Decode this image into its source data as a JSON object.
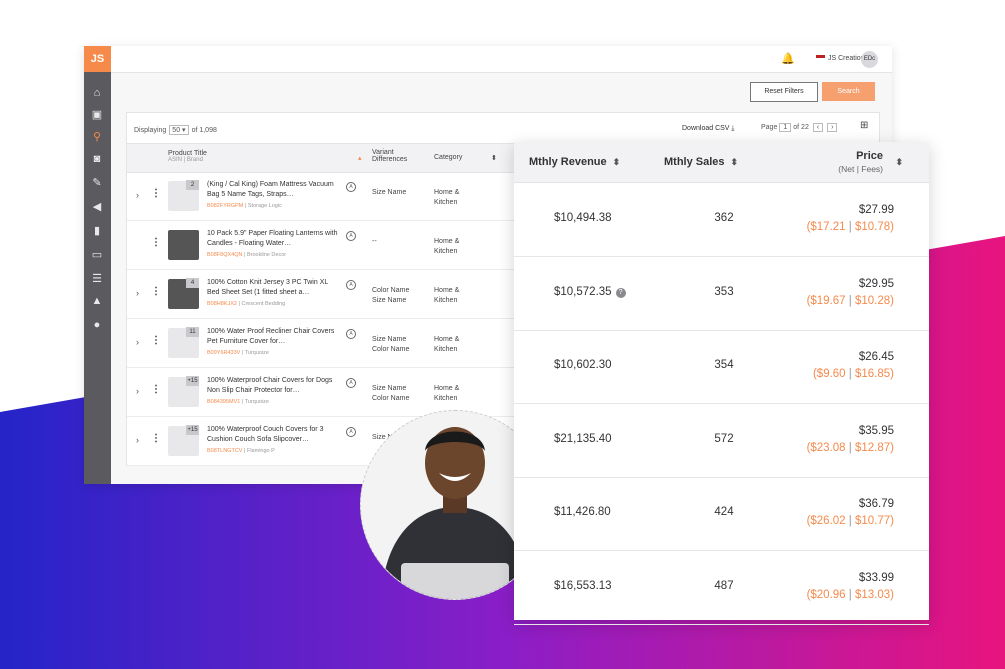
{
  "colors": {
    "accent": "#f58a4b",
    "sidebar": "#5b5b5f",
    "gradient_start": "#2424c8",
    "gradient_mid": "#8a1ec8",
    "gradient_end": "#e8147e"
  },
  "app": {
    "logo": "JS",
    "sidebar_icons": [
      "home-icon",
      "bag-icon",
      "search-icon",
      "binoculars-icon",
      "wrench-icon",
      "megaphone-icon",
      "chart-icon",
      "ad-icon",
      "list-icon",
      "graduation-icon",
      "globe-icon"
    ],
    "account_name": "JS Creations",
    "avatar_initials": "EDc",
    "reset_filters": "Reset Filters",
    "search": "Search",
    "displaying_label": "Displaying",
    "per_page": "50",
    "of_total": "of 1,098",
    "download_csv": "Download CSV",
    "page_label": "Page",
    "page_number": "1",
    "page_total": "of 22",
    "columns": {
      "product_title": "Product Title",
      "product_sub": "ASIN | Brand",
      "variant": "Variant Differences",
      "category": "Category"
    },
    "rows": [
      {
        "badge": "2",
        "title": "(King / Cal King) Foam Mattress Vacuum Bag 5 Name Tags, Straps…",
        "asin": "B082FYRGPM",
        "brand": "Storage Logic",
        "variant": "Size Name",
        "category": "Home & Kitchen",
        "chevron": "›"
      },
      {
        "badge": "",
        "title": "10 Pack 5.9\" Paper Floating Lanterns with Candles - Floating Water…",
        "asin": "B08F8QX4QN",
        "brand": "Brookline Decor",
        "variant": "--",
        "category": "Home & Kitchen",
        "chevron": ""
      },
      {
        "badge": "4",
        "title": "100% Cotton Knit Jersey 3 PC Twin XL Bed Sheet Set (1 fitted sheet a…",
        "asin": "B08H8KJX2",
        "brand": "Crescent Bedding",
        "variant": "Color Name Size Name",
        "category": "Home & Kitchen",
        "chevron": "›"
      },
      {
        "badge": "11",
        "title": "100% Water Proof Recliner Chair Covers Pet Furniture Cover for…",
        "asin": "B09Y6R433V",
        "brand": "Turquoize",
        "variant": "Size Name Color Name",
        "category": "Home & Kitchen",
        "chevron": "›"
      },
      {
        "badge": "+15",
        "title": "100% Waterproof Chair Covers for Dogs Non Slip Chair Protector for…",
        "asin": "B084395MV1",
        "brand": "Turquoize",
        "variant": "Size Name Color Name",
        "category": "Home & Kitchen",
        "chevron": "›"
      },
      {
        "badge": "+15",
        "title": "100% Waterproof Couch Covers for 3 Cushion Couch Sofa Slipcover…",
        "asin": "B08TLNGTCV",
        "brand": "Flamingo P",
        "variant": "Size N Col",
        "category": "",
        "chevron": "›"
      }
    ]
  },
  "card": {
    "headers": {
      "revenue": "Mthly Revenue",
      "sales": "Mthly Sales",
      "price": "Price",
      "price_sub": "(Net | Fees)"
    },
    "rows": [
      {
        "revenue": "$10,494.38",
        "sales": "362",
        "price": "$27.99",
        "net": "($17.21",
        "fees": "$10.78)",
        "has_info": false
      },
      {
        "revenue": "$10,572.35",
        "sales": "353",
        "price": "$29.95",
        "net": "($19.67",
        "fees": "$10.28)",
        "has_info": true
      },
      {
        "revenue": "$10,602.30",
        "sales": "354",
        "price": "$26.45",
        "net": "($9.60",
        "fees": "$16.85)",
        "has_info": false
      },
      {
        "revenue": "$21,135.40",
        "sales": "572",
        "price": "$35.95",
        "net": "($23.08",
        "fees": "$12.87)",
        "has_info": false
      },
      {
        "revenue": "$11,426.80",
        "sales": "424",
        "price": "$36.79",
        "net": "($26.02",
        "fees": "$10.77)",
        "has_info": false
      },
      {
        "revenue": "$16,553.13",
        "sales": "487",
        "price": "$33.99",
        "net": "($20.96",
        "fees": "$13.03)",
        "has_info": false
      }
    ]
  }
}
